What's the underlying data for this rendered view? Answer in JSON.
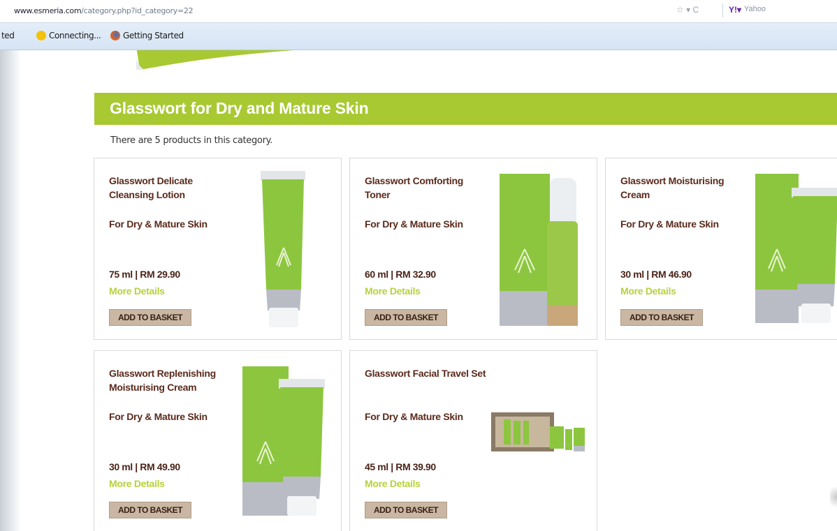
{
  "browser": {
    "url": "www.esmeria.com/category.php?id_category=22",
    "url_domain": "www.esmeria.com",
    "url_path": "/category.php?id_category=22",
    "controls": "☆ ▾ C",
    "search_placeholder": "Yahoo",
    "bookmarks": [
      "ted",
      "Connecting...",
      "Getting Started"
    ]
  },
  "category": {
    "title": "Glasswort for Dry and Mature Skin",
    "count_text": "There are 5 products in this category."
  },
  "products": [
    {
      "name": "Glasswort Delicate Cleansing Lotion",
      "skin": "For Dry & Mature Skin",
      "price": "75 ml | RM 29.90",
      "more": "More Details",
      "button": "ADD TO BASKET"
    },
    {
      "name": "Glasswort Comforting Toner",
      "skin": "For Dry & Mature Skin",
      "price": "60 ml | RM 32.90",
      "more": "More Details",
      "button": "ADD TO BASKET"
    },
    {
      "name": "Glasswort Moisturising Cream",
      "skin": "For Dry & Mature Skin",
      "price": "30 ml | RM 46.90",
      "more": "More Details",
      "button": "ADD TO BASKET"
    },
    {
      "name": "Glasswort Replenishing Moisturising Cream",
      "skin": "For Dry & Mature Skin",
      "price": "30 ml | RM 49.90",
      "more": "More Details",
      "button": "ADD TO BASKET"
    },
    {
      "name": "Glasswort Facial Travel Set",
      "skin": "For Dry & Mature Skin",
      "price": "45 ml | RM 39.90",
      "more": "More Details",
      "button": "ADD TO BASKET"
    }
  ],
  "colors": {
    "accent": "#a8c932",
    "text_brown": "#5b2a1c",
    "button": "#c9b7a3"
  }
}
